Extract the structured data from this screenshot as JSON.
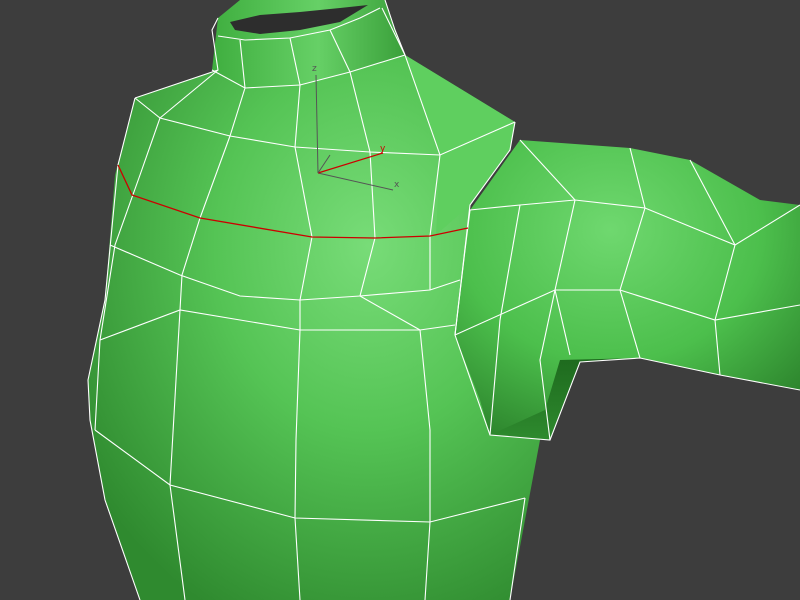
{
  "viewport": {
    "background_color": "#3d3d3d"
  },
  "model": {
    "fill_color": "#4fc04f",
    "highlight_color": "#7ee07e",
    "shadow_color": "#1f6a1f",
    "wire_color": "#ffffff",
    "selection_color": "#cc0000"
  },
  "gizmo": {
    "axis_color": "#555555",
    "y_axis_color": "#cc0000",
    "labels": {
      "x": "x",
      "y": "y",
      "z": "z"
    }
  }
}
